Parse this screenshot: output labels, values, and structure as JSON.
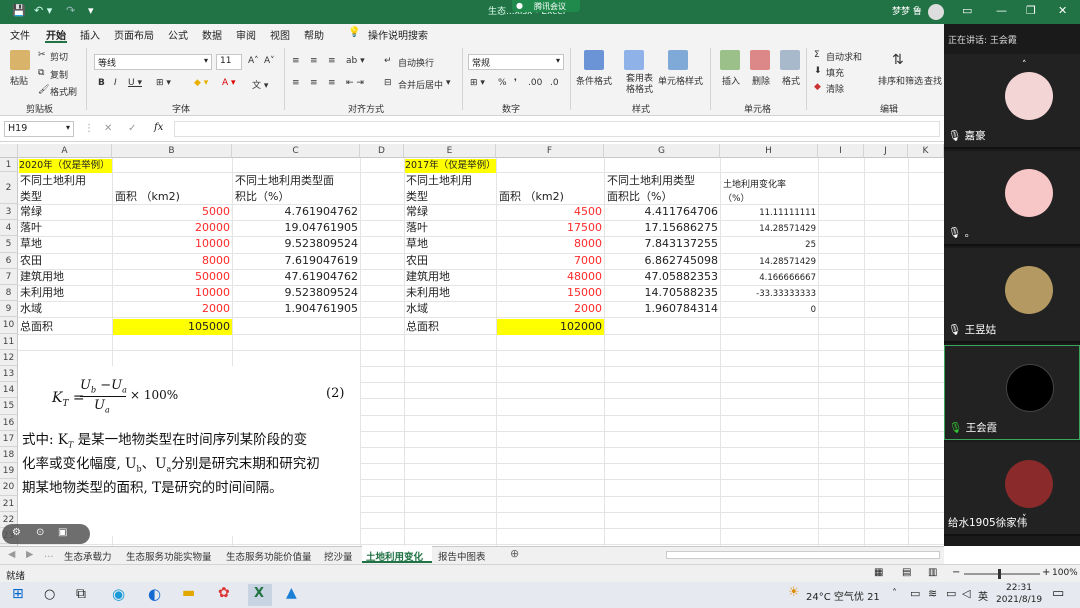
{
  "window": {
    "title": "生态...xlsx - Excel",
    "meeting_label": "腾讯会议",
    "user": "梦梦 鲁"
  },
  "menu": {
    "items": [
      "文件",
      "开始",
      "插入",
      "页面布局",
      "公式",
      "数据",
      "审阅",
      "视图",
      "帮助"
    ],
    "active": "开始",
    "tellme": "操作说明搜索"
  },
  "ribbon": {
    "paste": "粘贴",
    "cut": "剪切",
    "copy": "复制",
    "format_painter": "格式刷",
    "clipboard": "剪贴板",
    "font_name": "等线",
    "font_size": "11",
    "font_group": "字体",
    "wrap_text": "自动换行",
    "merge_center": "合并后居中",
    "align_group": "对齐方式",
    "number_format": "常规",
    "number_group": "数字",
    "cond_format": "条件格式",
    "table_format": "套用表格格式",
    "cell_style": "单元格样式",
    "style_group": "样式",
    "insert": "插入",
    "delete": "删除",
    "format": "格式",
    "cells_group": "单元格",
    "autosum": "自动求和",
    "fill": "填充",
    "clear": "清除",
    "sort_filter": "排序和筛选",
    "find_select": "查找",
    "edit_group": "编辑"
  },
  "formula_bar": {
    "name_box": "H19",
    "fx": "fx",
    "value": ""
  },
  "columns": [
    "A",
    "B",
    "C",
    "D",
    "E",
    "F",
    "G",
    "H",
    "I",
    "J",
    "K"
  ],
  "rows": [
    "1",
    "2",
    "3",
    "4",
    "5",
    "6",
    "7",
    "8",
    "9",
    "10",
    "11",
    "12",
    "13",
    "14",
    "15",
    "16",
    "17",
    "18",
    "19",
    "20",
    "21",
    "22",
    "23",
    "24",
    "25",
    "26",
    "27"
  ],
  "table2020": {
    "title": "2020年（仅是举例）",
    "h_type_1": "不同土地利用",
    "h_type_2": "类型",
    "h_area": "面积 （km2)",
    "h_ratio_1": "不同土地利用类型面",
    "h_ratio_2": "积比（%）",
    "rows": [
      {
        "type": "常绿",
        "area": "5000",
        "ratio": "4.761904762"
      },
      {
        "type": "落叶",
        "area": "20000",
        "ratio": "19.04761905"
      },
      {
        "type": "草地",
        "area": "10000",
        "ratio": "9.523809524"
      },
      {
        "type": "农田",
        "area": "8000",
        "ratio": "7.619047619"
      },
      {
        "type": "建筑用地",
        "area": "50000",
        "ratio": "47.61904762"
      },
      {
        "type": "未利用地",
        "area": "10000",
        "ratio": "9.523809524"
      },
      {
        "type": "水域",
        "area": "2000",
        "ratio": "1.904761905"
      }
    ],
    "total_label": "总面积",
    "total": "105000"
  },
  "table2017": {
    "title": "2017年（仅是举例）",
    "h_type_1": "不同土地利用",
    "h_type_2": "类型",
    "h_area": "面积 （km2)",
    "h_ratio_1": "不同土地利用类型",
    "h_ratio_2": "面积比（%）",
    "h_change_1": "土地利用变化率",
    "h_change_2": "（%）",
    "rows": [
      {
        "type": "常绿",
        "area": "4500",
        "ratio": "4.411764706",
        "change": "11.11111111"
      },
      {
        "type": "落叶",
        "area": "17500",
        "ratio": "17.15686275",
        "change": "14.28571429"
      },
      {
        "type": "草地",
        "area": "8000",
        "ratio": "7.843137255",
        "change": "25"
      },
      {
        "type": "农田",
        "area": "7000",
        "ratio": "6.862745098",
        "change": "14.28571429"
      },
      {
        "type": "建筑用地",
        "area": "48000",
        "ratio": "47.05882353",
        "change": "4.166666667"
      },
      {
        "type": "未利用地",
        "area": "15000",
        "ratio": "14.70588235",
        "change": "-33.33333333"
      },
      {
        "type": "水域",
        "area": "2000",
        "ratio": "1.960784314",
        "change": "0"
      }
    ],
    "total_label": "总面积",
    "total": "102000"
  },
  "formula_image": {
    "lhs": "K",
    "lhs_sub": "T",
    "num": "U",
    "num_sub1": "b",
    "num_op": " −U",
    "num_sub2": "a",
    "den": "U",
    "den_sub": "a",
    "times": "× 100%",
    "eqno": "(2)",
    "line1": "式中:  K",
    "line1_sub": "T",
    "line1_rest": " 是某一地物类型在时间序列某阶段的变",
    "line2_a": "化率或变化幅度, U",
    "line2_b": "b",
    "line2_c": "、U",
    "line2_d": "a",
    "line2_e": "分别是研究末期和研究初",
    "line3": "期某地物类型的面积, T是研究的时间间隔。"
  },
  "sheet_tabs": [
    "生态承载力",
    "生态服务功能实物量",
    "生态服务功能价值量",
    "挖沙量",
    "土地利用变化",
    "报告中图表"
  ],
  "active_sheet": "土地利用变化",
  "status": {
    "ready": "就绪",
    "zoom": "100%"
  },
  "meeting": {
    "speaking": "正在讲话: 王会霞",
    "participants": [
      "嘉豪",
      "。",
      "王昱姑",
      "王会霞",
      "给水1905徐家伟"
    ]
  },
  "taskbar": {
    "weather": "24°C 空气优 21",
    "ime": "英",
    "time": "22:31",
    "date": "2021/8/19"
  },
  "colors": {
    "excel_green": "#217346",
    "highlight": "#ffff00",
    "red_text": "#ff2a2a"
  }
}
